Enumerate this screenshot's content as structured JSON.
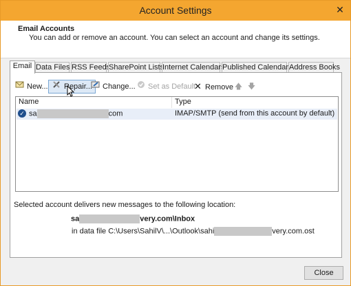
{
  "window": {
    "title": "Account Settings",
    "close_glyph": "✕"
  },
  "header": {
    "title": "Email Accounts",
    "description": "You can add or remove an account. You can select an account and change its settings."
  },
  "tabs": [
    {
      "label": "Email"
    },
    {
      "label": "Data Files"
    },
    {
      "label": "RSS Feeds"
    },
    {
      "label": "SharePoint Lists"
    },
    {
      "label": "Internet Calendars"
    },
    {
      "label": "Published Calendars"
    },
    {
      "label": "Address Books"
    }
  ],
  "toolbar": {
    "new": {
      "label": "New...",
      "icon": "new-account-icon"
    },
    "repair": {
      "label": "Repair...",
      "icon": "repair-tools-icon"
    },
    "change": {
      "label": "Change...",
      "icon": "change-icon"
    },
    "set_default": {
      "label": "Set as Default",
      "icon": "check-circle-icon"
    },
    "remove": {
      "label": "Remove",
      "icon": "x-icon"
    },
    "move_up": {
      "icon": "arrow-up-icon"
    },
    "move_down": {
      "icon": "arrow-down-icon"
    }
  },
  "account_list": {
    "columns": [
      "Name",
      "Type"
    ],
    "rows": [
      {
        "name_start": "sa",
        "name_end": "com",
        "type": "IMAP/SMTP (send from this account by default)"
      }
    ]
  },
  "delivery": {
    "text": "Selected account delivers new messages to the following location:",
    "folder_start": "sa",
    "folder_end": "very.com\\Inbox",
    "datafile_start": "in data file C:\\Users\\SahilV\\...\\Outlook\\sahi",
    "datafile_end": "very.com.ost"
  },
  "buttons": {
    "close": "Close"
  },
  "colors": {
    "titlebar": "#f4a630",
    "selected_row": "#e8eef8"
  }
}
